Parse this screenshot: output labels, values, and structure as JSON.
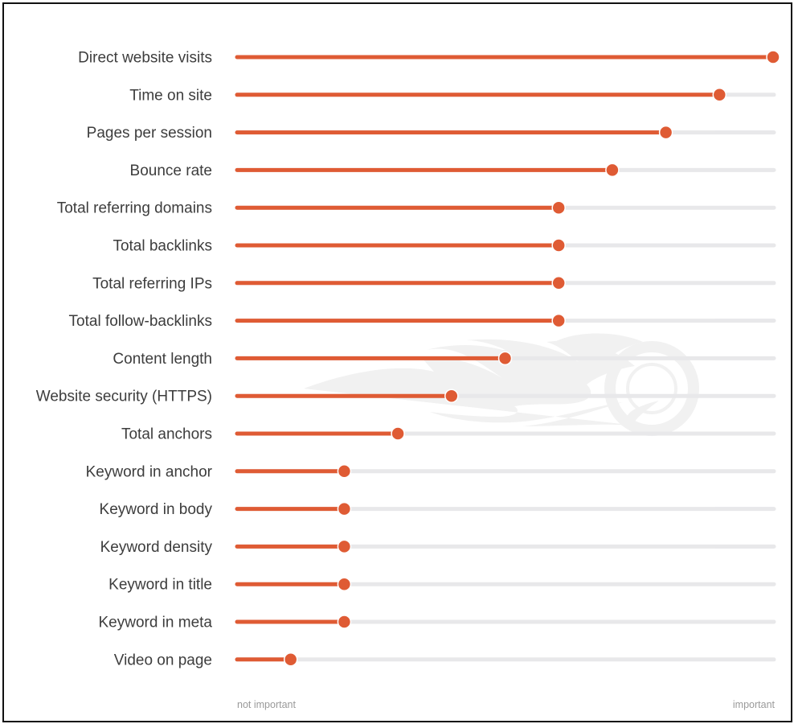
{
  "chart_data": {
    "type": "lollipop",
    "title": "",
    "xlabel": "",
    "ylabel": "",
    "xlim": [
      0,
      100
    ],
    "axis_labels": {
      "min": "not important",
      "max": "important"
    },
    "grid": false,
    "legend": "none",
    "categories": [
      "Direct website visits",
      "Time on site",
      "Pages per session",
      "Bounce rate",
      "Total referring domains",
      "Total backlinks",
      "Total referring IPs",
      "Total follow-backlinks",
      "Content length",
      "Website security (HTTPS)",
      "Total anchors",
      "Keyword in anchor",
      "Keyword in body",
      "Keyword density",
      "Keyword in title",
      "Keyword in meta",
      "Video on page"
    ],
    "values": [
      100,
      90,
      80,
      70,
      60,
      60,
      60,
      60,
      50,
      40,
      30,
      20,
      20,
      20,
      20,
      20,
      10
    ],
    "colors": {
      "fill": "#df5b34",
      "track": "#e8e8ea",
      "watermark": "#f1f1f1"
    },
    "watermark": "semrush-logo"
  }
}
